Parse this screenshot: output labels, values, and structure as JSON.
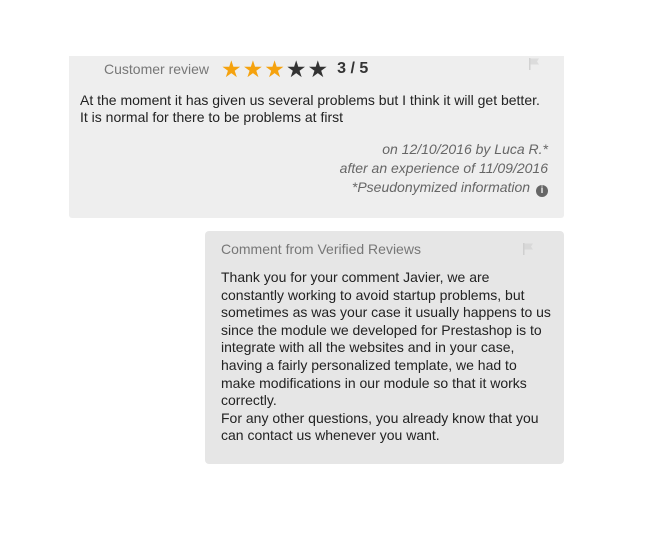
{
  "review": {
    "header_label": "Customer review",
    "rating": {
      "value": 3,
      "max": 5,
      "text": "3 / 5"
    },
    "stars": [
      "filled",
      "filled",
      "filled",
      "empty",
      "empty"
    ],
    "text": "At the moment it has given us several problems but I think it will get better. It is normal for there to be problems at first",
    "meta": {
      "date_line": "on 12/10/2016 by Luca R.*",
      "experience_line": "after an experience of 11/09/2016",
      "pseudonym_note": "*Pseudonymized information"
    },
    "colors": {
      "star_filled": "#f5a20e",
      "star_empty": "#333333",
      "card_bg": "#eeeeee"
    }
  },
  "reply": {
    "header": "Comment from Verified Reviews",
    "paragraphs": [
      "Thank you for your comment Javier, we are constantly working to avoid startup problems, but sometimes as was your case it usually happens to us since the module we developed for Prestashop is to integrate with all the websites and in your case, having a fairly personalized template, we had to make modifications in our module so that it works correctly.",
      "For any other questions, you already know that you can contact us whenever you want."
    ],
    "colors": {
      "card_bg": "#e6e6e6"
    }
  },
  "icons": {
    "flag": "flag-icon",
    "info": "info-icon",
    "star": "star-icon"
  }
}
